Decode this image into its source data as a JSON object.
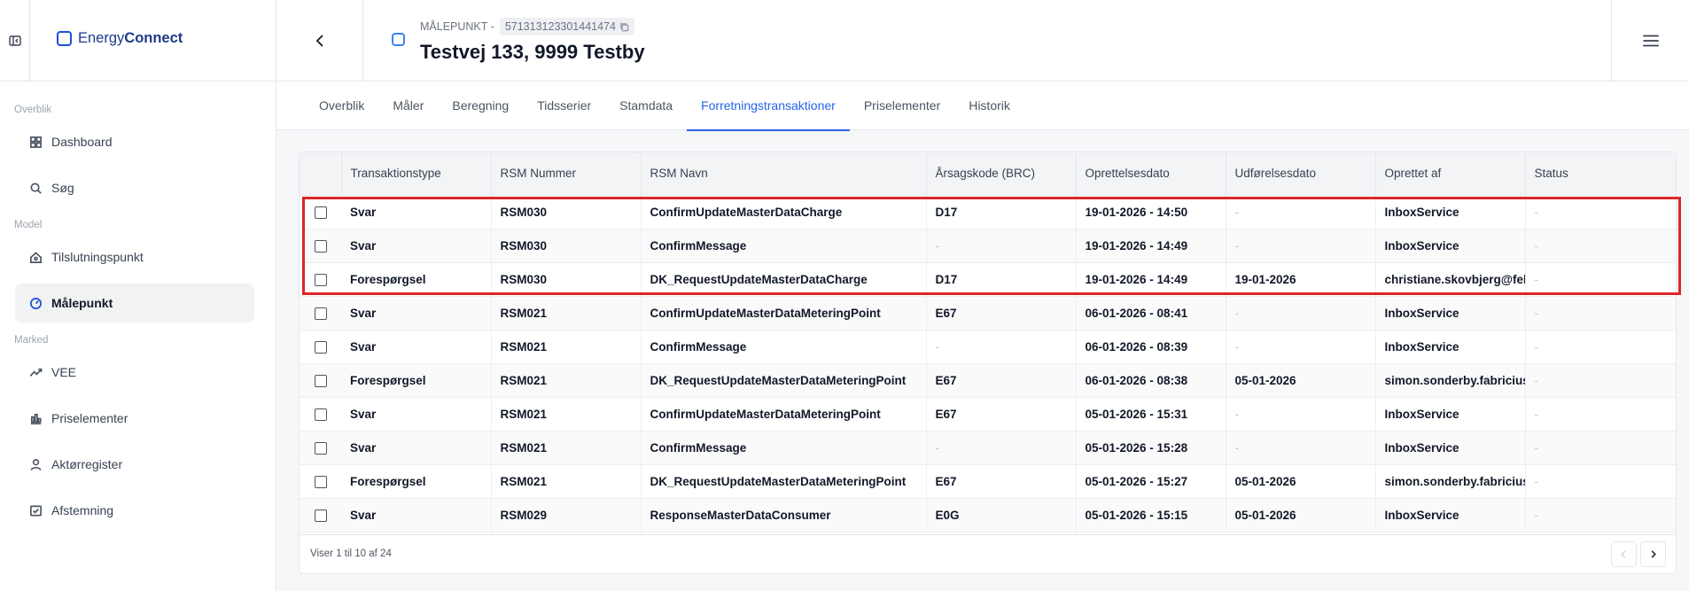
{
  "app": {
    "brand_light": "Energy",
    "brand_bold": "Connect"
  },
  "sidebar": {
    "sections": [
      {
        "label": "Overblik",
        "items": [
          {
            "label": "Dashboard",
            "icon": "dashboard-icon"
          },
          {
            "label": "Søg",
            "icon": "search-icon"
          }
        ]
      },
      {
        "label": "Model",
        "items": [
          {
            "label": "Tilslutningspunkt",
            "icon": "house-icon"
          },
          {
            "label": "Målepunkt",
            "icon": "gauge-icon",
            "active": true
          }
        ]
      },
      {
        "label": "Marked",
        "items": [
          {
            "label": "VEE",
            "icon": "trend-icon"
          },
          {
            "label": "Priselementer",
            "icon": "price-icon"
          },
          {
            "label": "Aktørregister",
            "icon": "person-icon"
          },
          {
            "label": "Afstemning",
            "icon": "reconcile-icon"
          }
        ]
      }
    ]
  },
  "header": {
    "label": "MÅLEPUNKT -",
    "id": "571313123301441474",
    "address": "Testvej 133, 9999 Testby"
  },
  "tabs": [
    "Overblik",
    "Måler",
    "Beregning",
    "Tidsserier",
    "Stamdata",
    "Forretningstransaktioner",
    "Priselementer",
    "Historik"
  ],
  "active_tab": "Forretningstransaktioner",
  "table": {
    "columns": [
      "Transaktionstype",
      "RSM Nummer",
      "RSM Navn",
      "Årsagskode (BRC)",
      "Oprettelsesdato",
      "Udførelsesdato",
      "Oprettet af",
      "Status"
    ],
    "rows": [
      [
        "Svar",
        "RSM030",
        "ConfirmUpdateMasterDataCharge",
        "D17",
        "19-01-2026 - 14:50",
        "-",
        "InboxService",
        "-"
      ],
      [
        "Svar",
        "RSM030",
        "ConfirmMessage",
        "-",
        "19-01-2026 - 14:49",
        "-",
        "InboxService",
        "-"
      ],
      [
        "Forespørgsel",
        "RSM030",
        "DK_RequestUpdateMasterDataCharge",
        "D17",
        "19-01-2026 - 14:49",
        "19-01-2026",
        "christiane.skovbjerg@fell",
        "-"
      ],
      [
        "Svar",
        "RSM021",
        "ConfirmUpdateMasterDataMeteringPoint",
        "E67",
        "06-01-2026 - 08:41",
        "-",
        "InboxService",
        "-"
      ],
      [
        "Svar",
        "RSM021",
        "ConfirmMessage",
        "-",
        "06-01-2026 - 08:39",
        "-",
        "InboxService",
        "-"
      ],
      [
        "Forespørgsel",
        "RSM021",
        "DK_RequestUpdateMasterDataMeteringPoint",
        "E67",
        "06-01-2026 - 08:38",
        "05-01-2026",
        "simon.sonderby.fabricius",
        "-"
      ],
      [
        "Svar",
        "RSM021",
        "ConfirmUpdateMasterDataMeteringPoint",
        "E67",
        "05-01-2026 - 15:31",
        "-",
        "InboxService",
        "-"
      ],
      [
        "Svar",
        "RSM021",
        "ConfirmMessage",
        "-",
        "05-01-2026 - 15:28",
        "-",
        "InboxService",
        "-"
      ],
      [
        "Forespørgsel",
        "RSM021",
        "DK_RequestUpdateMasterDataMeteringPoint",
        "E67",
        "05-01-2026 - 15:27",
        "05-01-2026",
        "simon.sonderby.fabricius",
        "-"
      ],
      [
        "Svar",
        "RSM029",
        "ResponseMasterDataConsumer",
        "E0G",
        "05-01-2026 - 15:15",
        "05-01-2026",
        "InboxService",
        "-"
      ]
    ],
    "count_text": "Viser 1 til 10 af 24"
  },
  "colors": {
    "accent": "#2563eb",
    "highlight": "#dc2626"
  }
}
